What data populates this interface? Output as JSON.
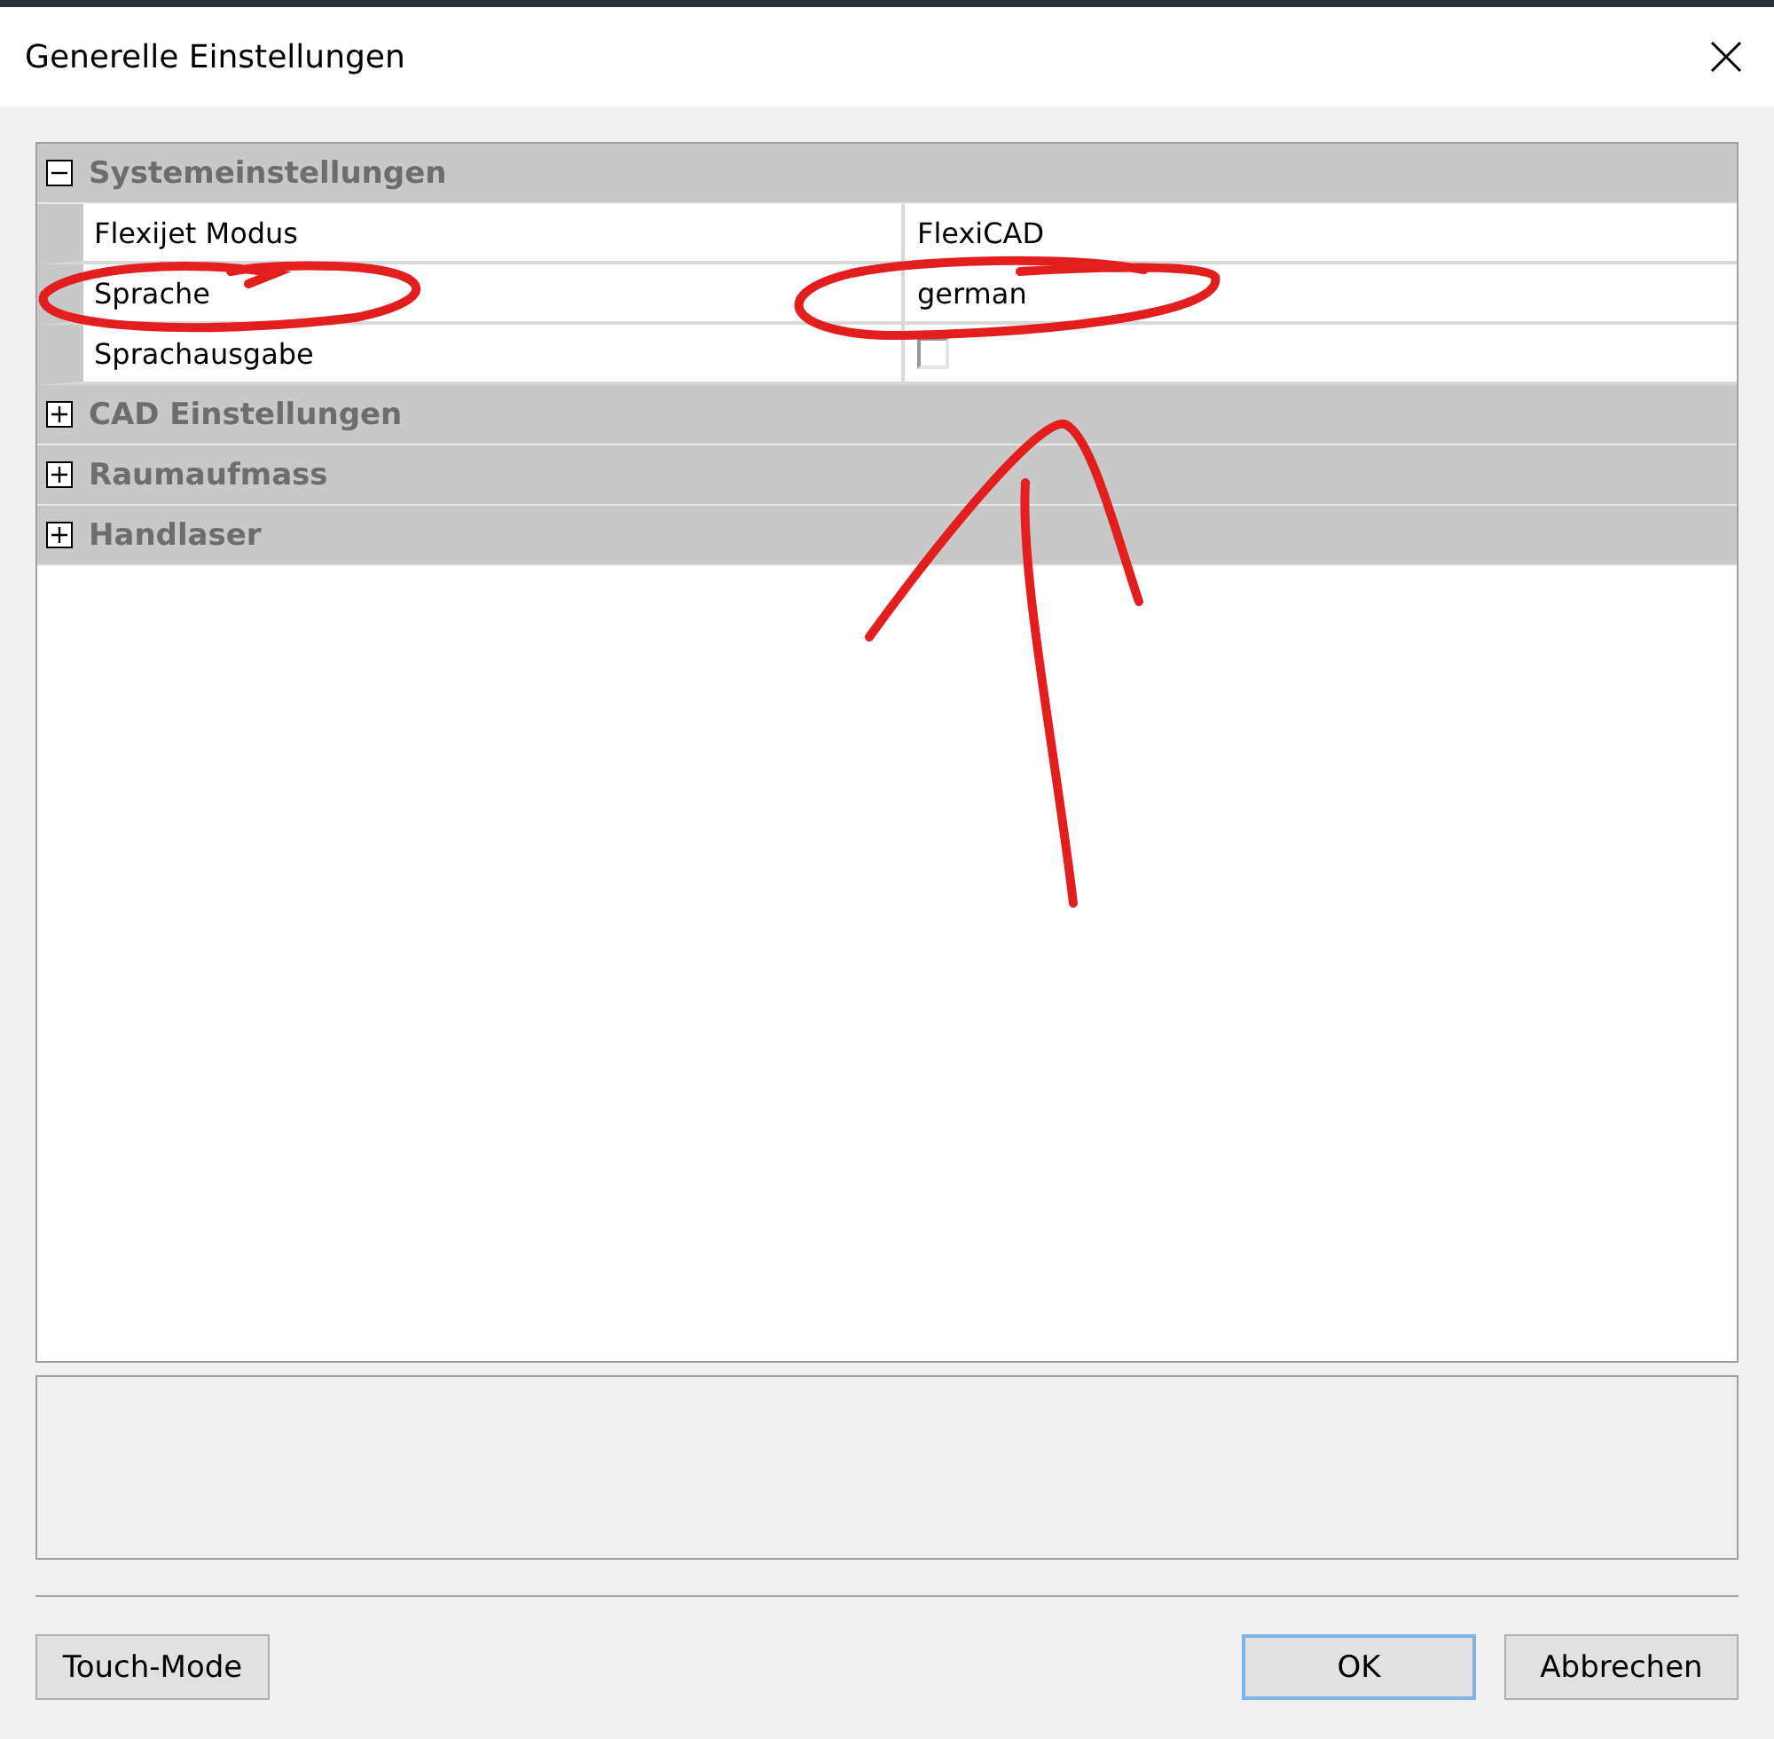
{
  "window": {
    "title": "Generelle Einstellungen"
  },
  "categories": [
    {
      "label": "Systemeinstellungen",
      "expanded": true,
      "properties": [
        {
          "kind": "text",
          "name": "Flexijet Modus",
          "value": "FlexiCAD"
        },
        {
          "kind": "text",
          "name": "Sprache",
          "value": "german"
        },
        {
          "kind": "checkbox",
          "name": "Sprachausgabe",
          "checked": false
        }
      ]
    },
    {
      "label": "CAD Einstellungen",
      "expanded": false
    },
    {
      "label": "Raumaufmass",
      "expanded": false
    },
    {
      "label": "Handlaser",
      "expanded": false
    }
  ],
  "buttons": [
    {
      "label": "Touch-Mode",
      "kind": "left",
      "default": false
    },
    {
      "label": "OK",
      "kind": "right",
      "default": true
    },
    {
      "label": "Abbrechen",
      "kind": "right",
      "default": false
    }
  ]
}
